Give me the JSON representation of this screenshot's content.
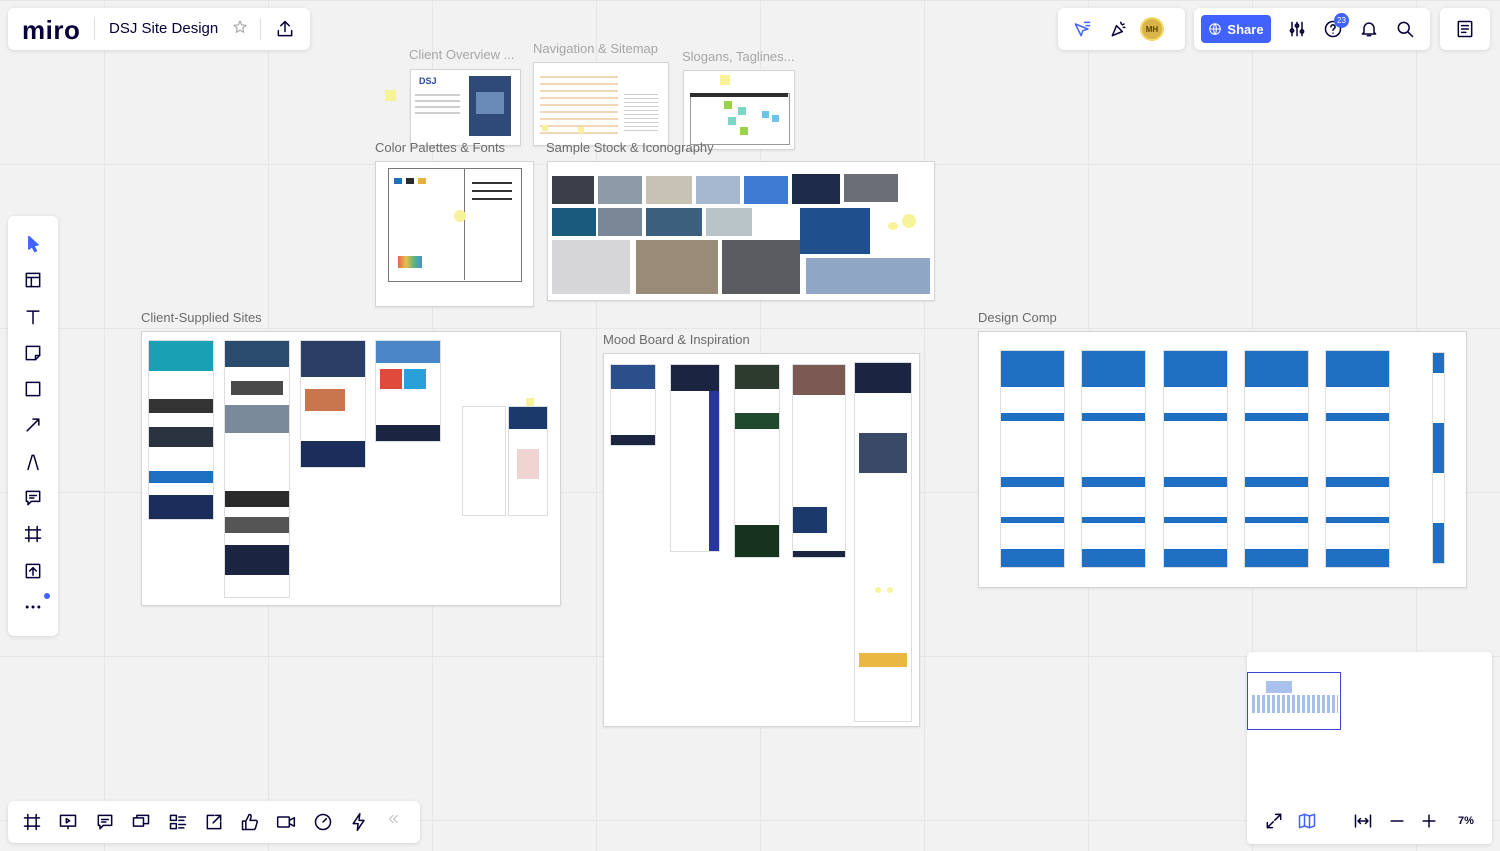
{
  "app": {
    "logo": "miro",
    "board_title": "DSJ Site Design"
  },
  "topbar": {
    "share_label": "Share",
    "avatar_initials": "MH",
    "help_badge": "23"
  },
  "frames": {
    "client_overview": "Client Overview ...",
    "navigation": "Navigation & Sitemap",
    "slogans": "Slogans, Taglines...",
    "color_palettes": "Color Palettes & Fonts",
    "sample_stock": "Sample Stock & Iconography",
    "client_sites": "Client-Supplied Sites",
    "mood_board": "Mood Board & Inspiration",
    "design_comp": "Design Comp"
  },
  "zoom": {
    "level": "7%"
  },
  "colors": {
    "accent": "#4262ff",
    "bg": "#f2f2f2",
    "nav_blue": "#1f6fc2",
    "sticky": "#f6f39a"
  },
  "toolbar_left_icons": [
    "select-icon",
    "templates-icon",
    "text-icon",
    "sticky-note-icon",
    "shape-icon",
    "connection-line-icon",
    "pen-icon",
    "comment-icon",
    "frame-icon",
    "upload-icon",
    "more-icon"
  ],
  "toolbar_bottom_icons": [
    "frames-icon",
    "presentation-icon",
    "comments-icon",
    "screens-icon",
    "card-icon",
    "share-screen-icon",
    "voting-icon",
    "video-icon",
    "timer-icon",
    "activity-icon",
    "collapse-icon"
  ]
}
